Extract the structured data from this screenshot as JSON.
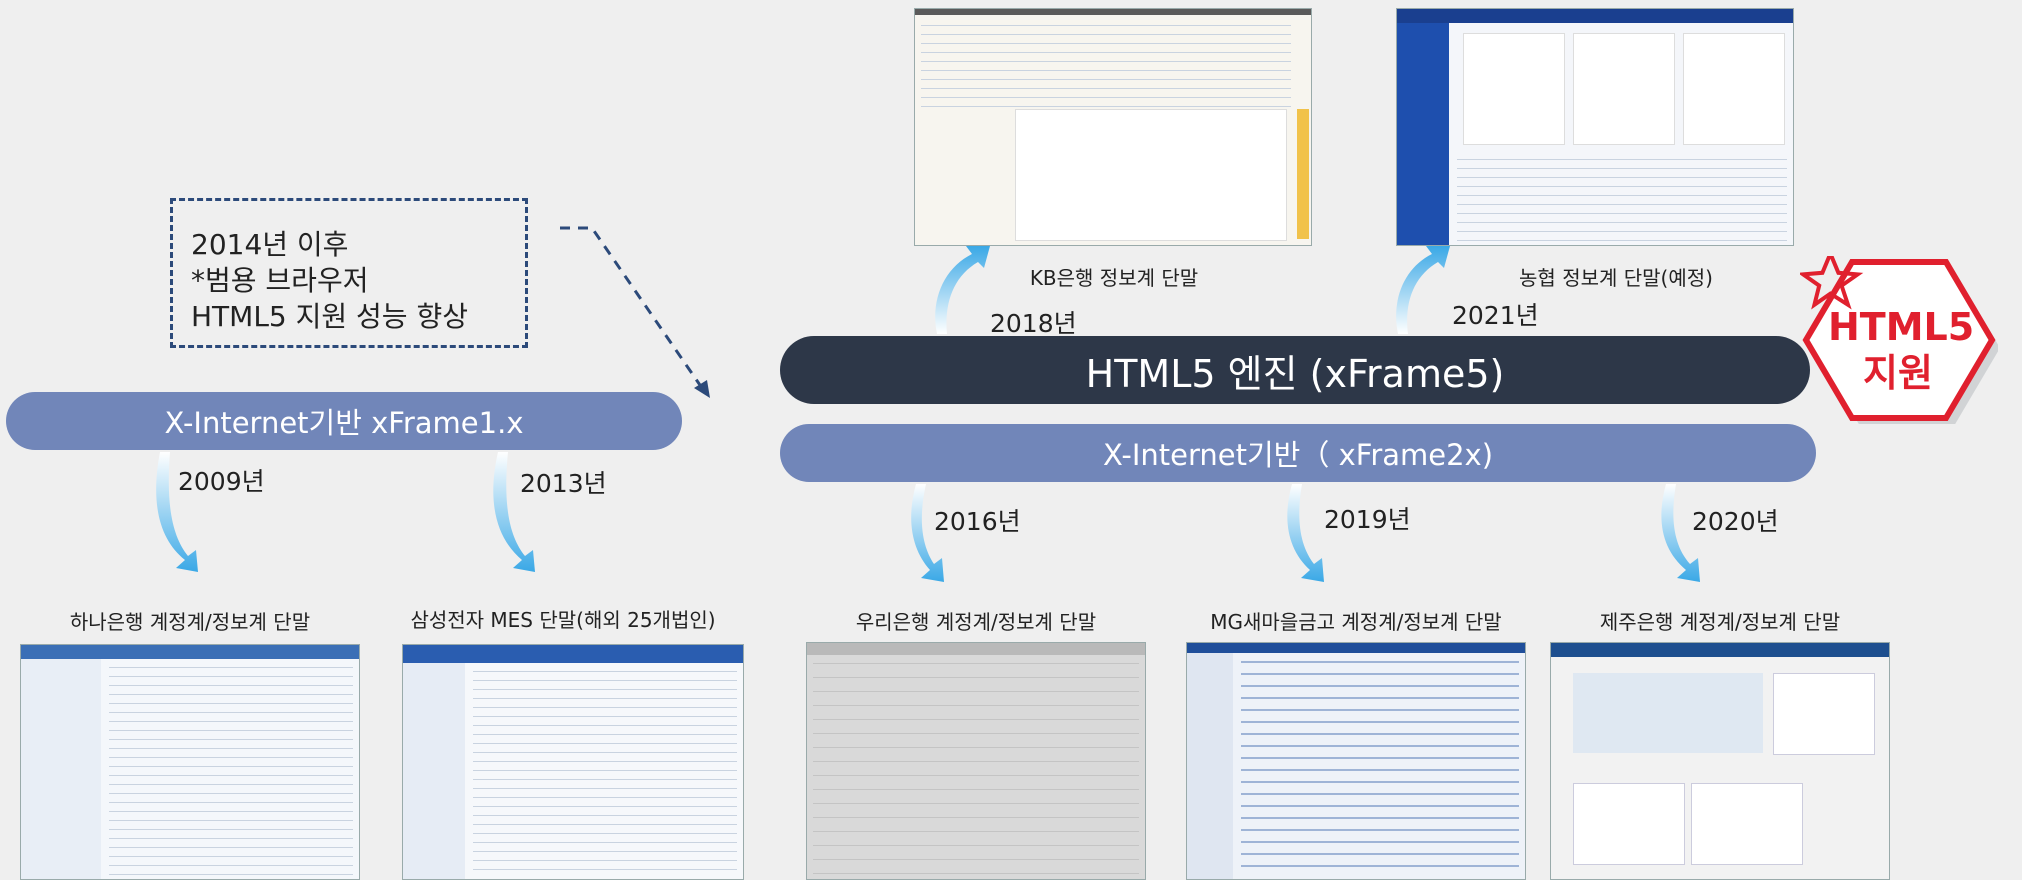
{
  "note": {
    "lines": [
      "2014년 이후",
      "*범용 브라우저",
      " HTML5 지원 성능 향상"
    ]
  },
  "bars": {
    "xframe1": "X-Internet기반 xFrame1.x",
    "engine": "HTML5 엔진 (xFrame5)",
    "xframe2": "X-Internet기반（ xFrame2x)"
  },
  "badge": {
    "line1": "HTML5",
    "line2": "지원",
    "color": "#e0202e"
  },
  "milestones": {
    "hana": {
      "year": "2009년",
      "caption": "하나은행 계정계/정보계 단말"
    },
    "samsung": {
      "year": "2013년",
      "caption": "삼성전자 MES 단말(해외 25개법인)"
    },
    "woori": {
      "year": "2016년",
      "caption": "우리은행 계정계/정보계 단말"
    },
    "mg": {
      "year": "2019년",
      "caption": "MG새마을금고 계정계/정보계 단말"
    },
    "jeju": {
      "year": "2020년",
      "caption": "제주은행 계정계/정보계 단말"
    },
    "kb": {
      "year": "2018년",
      "caption": "KB은행 정보계 단말"
    },
    "nh": {
      "year": "2021년",
      "caption": "농협 정보계 단말(예정)"
    }
  },
  "colors": {
    "bar_light": "#7186b9",
    "bar_dark": "#2d3748",
    "arrow": "#4fb3e8",
    "note_border": "#2c4a7a"
  }
}
